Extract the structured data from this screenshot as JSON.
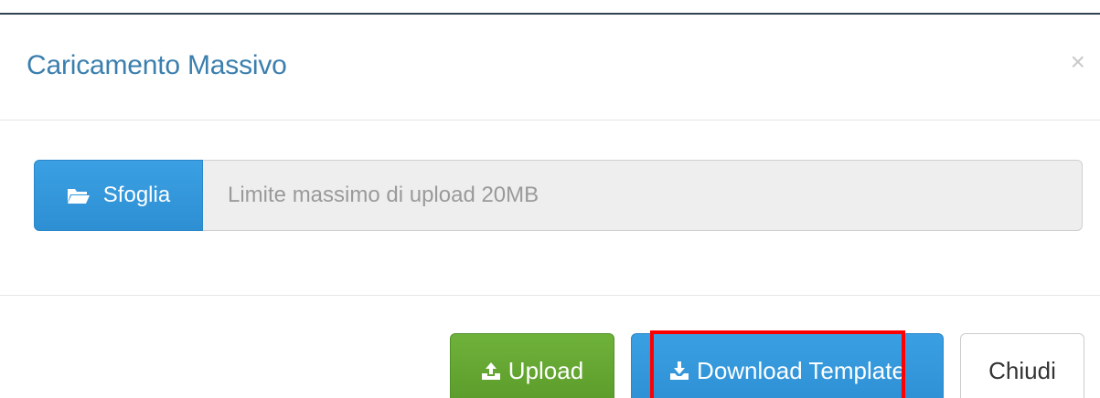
{
  "modal": {
    "title": "Caricamento Massivo",
    "close_glyph": "×"
  },
  "file_upload": {
    "browse_label": "Sfoglia",
    "browse_icon": "folder-open-icon",
    "placeholder": "Limite massimo di upload 20MB",
    "value": ""
  },
  "footer": {
    "upload_label": "Upload",
    "upload_icon": "upload-icon",
    "download_label": "Download Template",
    "download_icon": "download-icon",
    "close_label": "Chiudi"
  },
  "colors": {
    "title": "#3b7fae",
    "primary": "#3498db",
    "success": "#5fa431",
    "highlight": "#ff0000"
  }
}
